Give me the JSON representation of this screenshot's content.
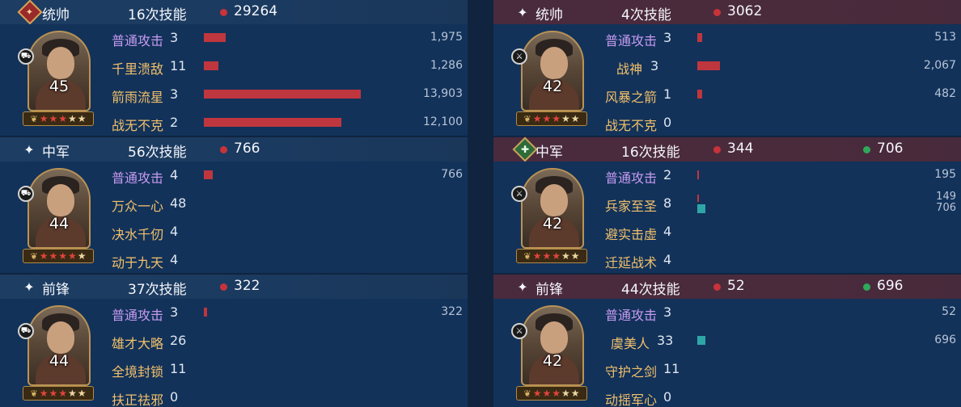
{
  "left": {
    "blocks": [
      {
        "role": "统帅",
        "header_icon": "red-diamond-badge-icon",
        "casts": "16次技能",
        "damage": "29264",
        "heal": null,
        "level": "45",
        "stars_red": 3,
        "stars_gold": 2,
        "skills": [
          {
            "name": "普通攻击",
            "count": "3",
            "bar": 0.05,
            "amount": "1,975",
            "normal": true
          },
          {
            "name": "千里溃敌",
            "count": "11",
            "bar": 0.033,
            "amount": "1,286"
          },
          {
            "name": "箭雨流星",
            "count": "3",
            "bar": 0.36,
            "amount": "13,903"
          },
          {
            "name": "战无不克",
            "count": "2",
            "bar": 0.314,
            "amount": "12,100"
          }
        ]
      },
      {
        "role": "中军",
        "header_icon": "sparkle-icon",
        "casts": "56次技能",
        "damage": "766",
        "heal": null,
        "level": "44",
        "stars_red": 4,
        "stars_gold": 1,
        "skills": [
          {
            "name": "普通攻击",
            "count": "4",
            "bar": 0.02,
            "amount": "766",
            "normal": true
          },
          {
            "name": "万众一心",
            "count": "48",
            "bar": 0,
            "amount": ""
          },
          {
            "name": "决水千仞",
            "count": "4",
            "bar": 0,
            "amount": ""
          },
          {
            "name": "动于九天",
            "count": "4",
            "bar": 0,
            "amount": ""
          }
        ]
      },
      {
        "role": "前锋",
        "header_icon": "sparkle-icon",
        "casts": "37次技能",
        "damage": "322",
        "heal": null,
        "level": "44",
        "stars_red": 3,
        "stars_gold": 2,
        "skills": [
          {
            "name": "普通攻击",
            "count": "3",
            "bar": 0.008,
            "amount": "322",
            "normal": true
          },
          {
            "name": "雄才大略",
            "count": "26",
            "bar": 0,
            "amount": ""
          },
          {
            "name": "全境封锁",
            "count": "11",
            "bar": 0,
            "amount": ""
          },
          {
            "name": "扶正祛邪",
            "count": "0",
            "bar": 0,
            "amount": ""
          }
        ]
      }
    ]
  },
  "right": {
    "blocks": [
      {
        "role": "统帅",
        "header_icon": "sparkle-icon",
        "casts": "4次技能",
        "damage": "3062",
        "heal": null,
        "level": "42",
        "stars_red": 3,
        "stars_gold": 2,
        "skills": [
          {
            "name": "普通攻击",
            "count": "3",
            "bar": 0.012,
            "amount": "513",
            "normal": true
          },
          {
            "name": "战神",
            "count": "3",
            "bar": 0.052,
            "amount": "2,067"
          },
          {
            "name": "风暴之箭",
            "count": "1",
            "bar": 0.012,
            "amount": "482"
          },
          {
            "name": "战无不克",
            "count": "0",
            "bar": 0,
            "amount": ""
          }
        ]
      },
      {
        "role": "中军",
        "header_icon": "green-heart-badge-icon",
        "casts": "16次技能",
        "damage": "344",
        "heal": "706",
        "level": "42",
        "stars_red": 3,
        "stars_gold": 2,
        "skills": [
          {
            "name": "普通攻击",
            "count": "2",
            "bar": 0.004,
            "amount": "195",
            "normal": true
          },
          {
            "name": "兵家至圣",
            "count": "8",
            "bar": 0.004,
            "amount": "149",
            "heal_bar": 0.018,
            "heal_amount": "706"
          },
          {
            "name": "避实击虚",
            "count": "4",
            "bar": 0,
            "amount": ""
          },
          {
            "name": "迁延战术",
            "count": "4",
            "bar": 0,
            "amount": ""
          }
        ]
      },
      {
        "role": "前锋",
        "header_icon": "sparkle-icon",
        "casts": "44次技能",
        "damage": "52",
        "heal": "696",
        "level": "42",
        "stars_red": 3,
        "stars_gold": 2,
        "skills": [
          {
            "name": "普通攻击",
            "count": "3",
            "bar": 0,
            "amount": "52",
            "normal": true
          },
          {
            "name": "虞美人",
            "count": "33",
            "bar": 0,
            "amount": "696",
            "teal": 0.018
          },
          {
            "name": "守护之剑",
            "count": "11",
            "bar": 0,
            "amount": ""
          },
          {
            "name": "动摇军心",
            "count": "0",
            "bar": 0,
            "amount": ""
          }
        ]
      }
    ]
  },
  "colors": {
    "damage_dot": "#c8333a",
    "heal_dot": "#2fa85a",
    "damage_bar": "#c0363e",
    "heal_bar": "#2ea6a6",
    "skill_gold": "#f2c06a",
    "skill_normal": "#c79bf0"
  }
}
